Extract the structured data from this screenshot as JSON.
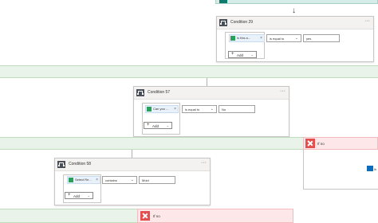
{
  "condition_top": {
    "title": "Condition 29",
    "more": "···",
    "token_label": "Is this a...",
    "operator": "is equal to",
    "value": "yes",
    "add_label": "Add"
  },
  "condition_mid": {
    "title": "Condition 57",
    "more": "···",
    "token_label": "Can you ...",
    "operator": "is equal to",
    "value": "No",
    "add_label": "Add"
  },
  "condition_low": {
    "title": "Condition 58",
    "more": "···",
    "token_label": "Select Re...",
    "operator": "contains",
    "value": "Mold",
    "add_label": "Add"
  },
  "if_no_right": {
    "label": "If no"
  },
  "if_no_bottom": {
    "label": "If no"
  },
  "partial_right_node": {
    "label": "Ib"
  },
  "icons": {
    "arrow": "↓",
    "close": "×",
    "chevron": "⌄",
    "plus": "+"
  },
  "colors": {
    "if_yes_band": "#eaf3ea",
    "if_no_band": "#fde7e9",
    "if_no_icon": "#e34f4f",
    "token": "#e9f2fb",
    "dynamic_content_icon": "#2aa05a"
  }
}
